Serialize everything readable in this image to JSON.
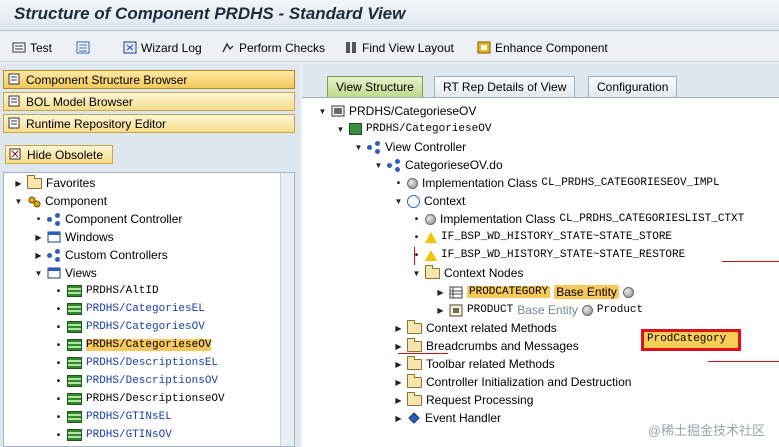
{
  "window": {
    "title": "Structure of Component PRDHS - Standard View"
  },
  "toolbar": {
    "test": "Test",
    "wizard_log": "Wizard Log",
    "perform_checks": "Perform Checks",
    "find_view_layout": "Find View Layout",
    "enhance_component": "Enhance Component"
  },
  "left_nav": {
    "component_structure_browser": "Component Structure Browser",
    "bol_model_browser": "BOL Model Browser",
    "runtime_repository_editor": "Runtime Repository Editor",
    "hide_obsolete": "Hide Obsolete"
  },
  "left_tree": [
    "Favorites",
    "Component",
    "Component Controller",
    "Windows",
    "Custom Controllers",
    "Views",
    "PRDHS/AltID",
    "PRDHS/CategoriesEL",
    "PRDHS/CategoriesOV",
    "PRDHS/CategorieseOV",
    "PRDHS/DescriptionsEL",
    "PRDHS/DescriptionsOV",
    "PRDHS/DescriptionseOV",
    "PRDHS/GTINsEL",
    "PRDHS/GTINsOV"
  ],
  "tabs": [
    "View Structure",
    "RT Rep Details of View",
    "Configuration"
  ],
  "right_tree": {
    "root": "PRDHS/CategorieseOV",
    "view": "PRDHS/CategorieseOV",
    "view_controller": "View Controller",
    "controller_file": "CategorieseOV.do",
    "impl_class_label": "Implementation Class",
    "impl_class_value": "CL_PRDHS_CATEGORIESEOV_IMPL",
    "context": "Context",
    "ctx_impl_class_label": "Implementation Class",
    "ctx_impl_class_value": "CL_PRDHS_CATEGORIESLIST_CTXT",
    "warn1": "IF_BSP_WD_HISTORY_STATE~STATE_STORE",
    "warn2": "IF_BSP_WD_HISTORY_STATE~STATE_RESTORE",
    "context_nodes": "Context Nodes",
    "node1_name": "PRODCATEGORY",
    "node1_label": "Base Entity",
    "node1_value": "ProdCategory",
    "node2_name": "PRODUCT",
    "node2_label": "Base Entity",
    "node2_value": "Product",
    "folders": [
      "Context related Methods",
      "Breadcrumbs and Messages",
      "Toolbar related Methods",
      "Controller Initialization and Destruction",
      "Request Processing"
    ],
    "event_handler": "Event Handler"
  },
  "watermark": "@稀土掘金技术社区"
}
